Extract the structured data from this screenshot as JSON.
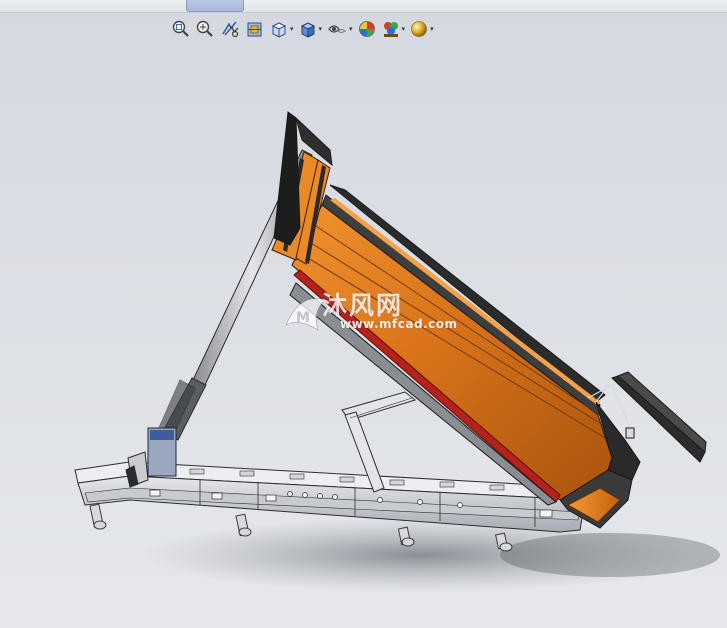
{
  "toolbar": {
    "items": [
      {
        "name": "zoom-to-fit",
        "icon": "zoom-fit-icon",
        "has_dropdown": false
      },
      {
        "name": "zoom-to-area",
        "icon": "zoom-area-icon",
        "has_dropdown": false
      },
      {
        "name": "previous-view",
        "icon": "previous-view-icon",
        "has_dropdown": false
      },
      {
        "name": "section-view",
        "icon": "section-view-icon",
        "has_dropdown": false
      },
      {
        "name": "view-orientation",
        "icon": "view-orientation-icon",
        "has_dropdown": true
      },
      {
        "name": "display-style",
        "icon": "display-style-icon",
        "has_dropdown": true
      },
      {
        "name": "hide-show-items",
        "icon": "hide-show-icon",
        "has_dropdown": true
      },
      {
        "name": "edit-appearance",
        "icon": "appearance-icon",
        "has_dropdown": false
      },
      {
        "name": "apply-scene",
        "icon": "scene-icon",
        "has_dropdown": true
      },
      {
        "name": "view-settings",
        "icon": "view-settings-icon",
        "has_dropdown": true
      }
    ]
  },
  "watermark": {
    "text_cn": "沐风网",
    "url": "www.mfcad.com"
  },
  "colors": {
    "background": "#d9dce2",
    "body_orange": "#d9761c",
    "frame_grey": "#b9bcc2",
    "dark_edge": "#1c1c1c"
  }
}
